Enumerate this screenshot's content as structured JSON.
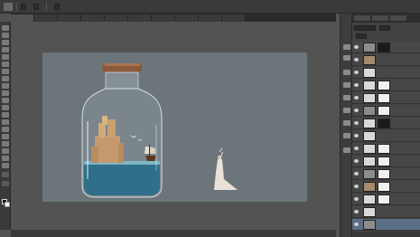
{
  "options_bar": {
    "labels": [
      "",
      "",
      "",
      "",
      ""
    ],
    "fields": [
      "",
      "",
      ""
    ]
  },
  "tabs": [
    {
      "label": "",
      "active": true
    },
    {
      "label": "",
      "active": false
    },
    {
      "label": "",
      "active": false
    },
    {
      "label": "",
      "active": false
    },
    {
      "label": "",
      "active": false
    },
    {
      "label": "",
      "active": false
    },
    {
      "label": "",
      "active": false
    },
    {
      "label": "",
      "active": false
    },
    {
      "label": "",
      "active": false
    },
    {
      "label": "",
      "active": false
    }
  ],
  "status": {
    "zoom": "",
    "doc_info": ""
  },
  "layers_panel": {
    "tabs": [
      "",
      "",
      ""
    ],
    "blend_mode": "",
    "opacity_label": "",
    "opacity_value": "",
    "fill_label": "",
    "fill_value": ""
  },
  "layers": [
    {
      "name": ""
    },
    {
      "name": ""
    },
    {
      "name": ""
    },
    {
      "name": ""
    },
    {
      "name": ""
    },
    {
      "name": ""
    },
    {
      "name": ""
    },
    {
      "name": ""
    },
    {
      "name": ""
    },
    {
      "name": ""
    },
    {
      "name": ""
    },
    {
      "name": ""
    },
    {
      "name": ""
    },
    {
      "name": ""
    },
    {
      "name": ""
    }
  ],
  "colors": {
    "canvas_bg": "#6b757a",
    "workspace_bg": "#535353",
    "selected_layer": "#5b6e86",
    "cork": "#8a5a3a",
    "sea": "#2f6f8a",
    "castle": "#c49a6c"
  }
}
